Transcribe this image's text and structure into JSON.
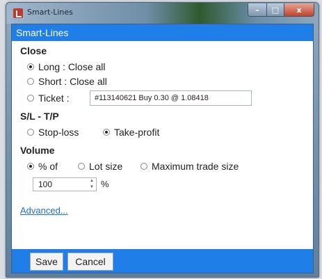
{
  "window": {
    "title": "Smart-Lines",
    "minimize_glyph": "–",
    "maximize_glyph": "□",
    "close_glyph": "x"
  },
  "dialog": {
    "header": "Smart-Lines",
    "close_section": {
      "title": "Close",
      "options": [
        {
          "label": "Long : Close all",
          "checked": true
        },
        {
          "label": "Short : Close all",
          "checked": false
        },
        {
          "label": "Ticket :",
          "checked": false
        }
      ],
      "ticket_value": "#113140621 Buy 0.30 @ 1.08418"
    },
    "sltp_section": {
      "title": "S/L - T/P",
      "options": [
        {
          "label": "Stop-loss",
          "checked": false
        },
        {
          "label": "Take-profit",
          "checked": true
        }
      ]
    },
    "volume_section": {
      "title": "Volume",
      "options": [
        {
          "label": "% of",
          "checked": true
        },
        {
          "label": "Lot size",
          "checked": false
        },
        {
          "label": "Maximum trade size",
          "checked": false
        }
      ],
      "amount_value": "100",
      "amount_unit": "%",
      "spin_up": "▲",
      "spin_down": "▼"
    },
    "advanced_link": "Advanced...",
    "buttons": {
      "save": "Save",
      "cancel": "Cancel"
    }
  },
  "colors": {
    "accent": "#1f7ee8",
    "link": "#1f6fd6"
  }
}
